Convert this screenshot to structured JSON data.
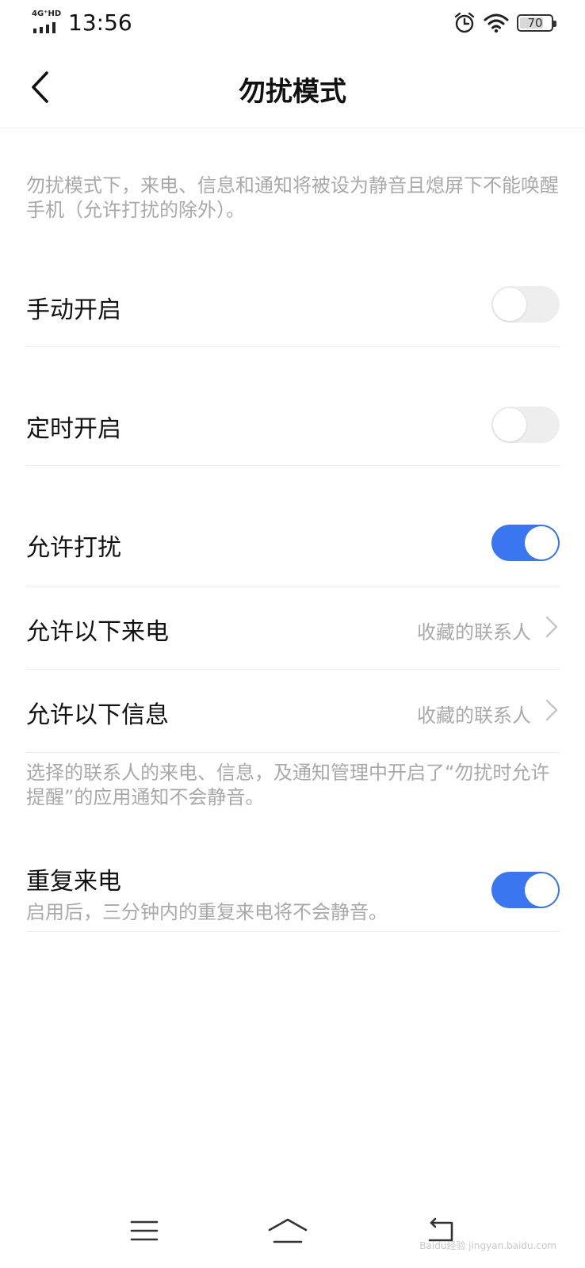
{
  "status_bar": {
    "network": "4G⁺HD",
    "time": "13:56",
    "battery": "70",
    "battery_level": 0.7
  },
  "header": {
    "title": "勿扰模式"
  },
  "intro": "勿扰模式下，来电、信息和通知将被设为静音且熄屏下不能唤醒手机（允许打扰的除外）。",
  "settings": {
    "manual": {
      "label": "手动开启",
      "on": false
    },
    "scheduled": {
      "label": "定时开启",
      "on": false
    },
    "allow_disturb": {
      "label": "允许打扰",
      "on": true
    },
    "allow_calls": {
      "label": "允许以下来电",
      "value": "收藏的联系人"
    },
    "allow_messages": {
      "label": "允许以下信息",
      "value": "收藏的联系人"
    },
    "allow_note": "选择的联系人的来电、信息，及通知管理中开启了“勿扰时允许提醒”的应用通知不会静音。",
    "repeat_calls": {
      "label": "重复来电",
      "subtitle": "启用后，三分钟内的重复来电将不会静音。",
      "on": true
    }
  },
  "colors": {
    "accent": "#3a76f0",
    "secondary_text": "#a9a9a9"
  },
  "watermark": "Baidu经验 jingyan.baidu.com"
}
